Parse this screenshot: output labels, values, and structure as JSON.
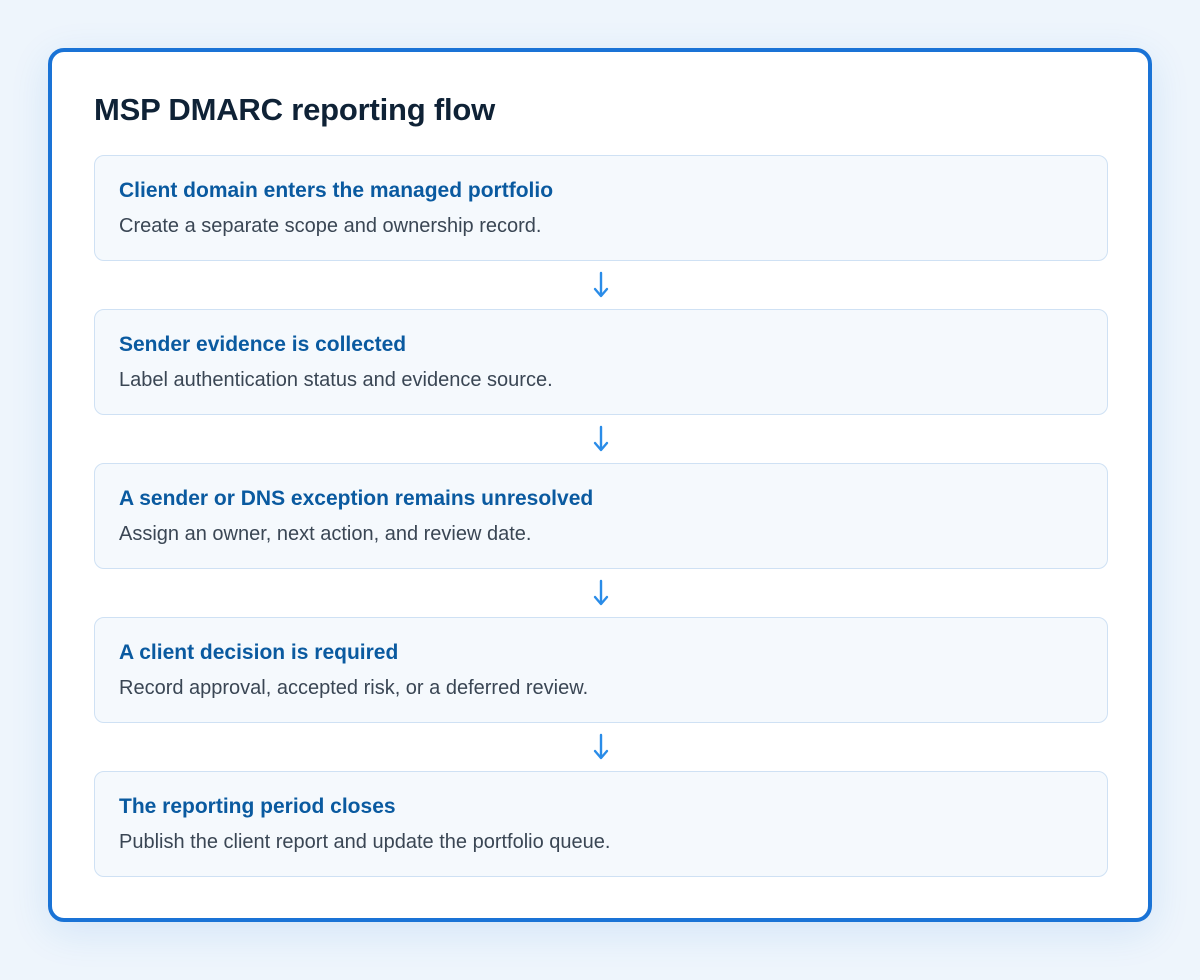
{
  "title": "MSP DMARC reporting flow",
  "steps": [
    {
      "title": "Client domain enters the managed portfolio",
      "description": "Create a separate scope and ownership record."
    },
    {
      "title": "Sender evidence is collected",
      "description": "Label authentication status and evidence source."
    },
    {
      "title": "A sender or DNS exception remains unresolved",
      "description": "Assign an owner, next action, and review date."
    },
    {
      "title": "A client decision is required",
      "description": "Record approval, accepted risk, or a deferred review."
    },
    {
      "title": "The reporting period closes",
      "description": "Publish the client report and update the portfolio queue."
    }
  ],
  "colors": {
    "accent": "#1a73d6",
    "step_title": "#0a5aa0",
    "arrow": "#2a8ce8"
  },
  "connector_icon": "arrow-down-icon"
}
